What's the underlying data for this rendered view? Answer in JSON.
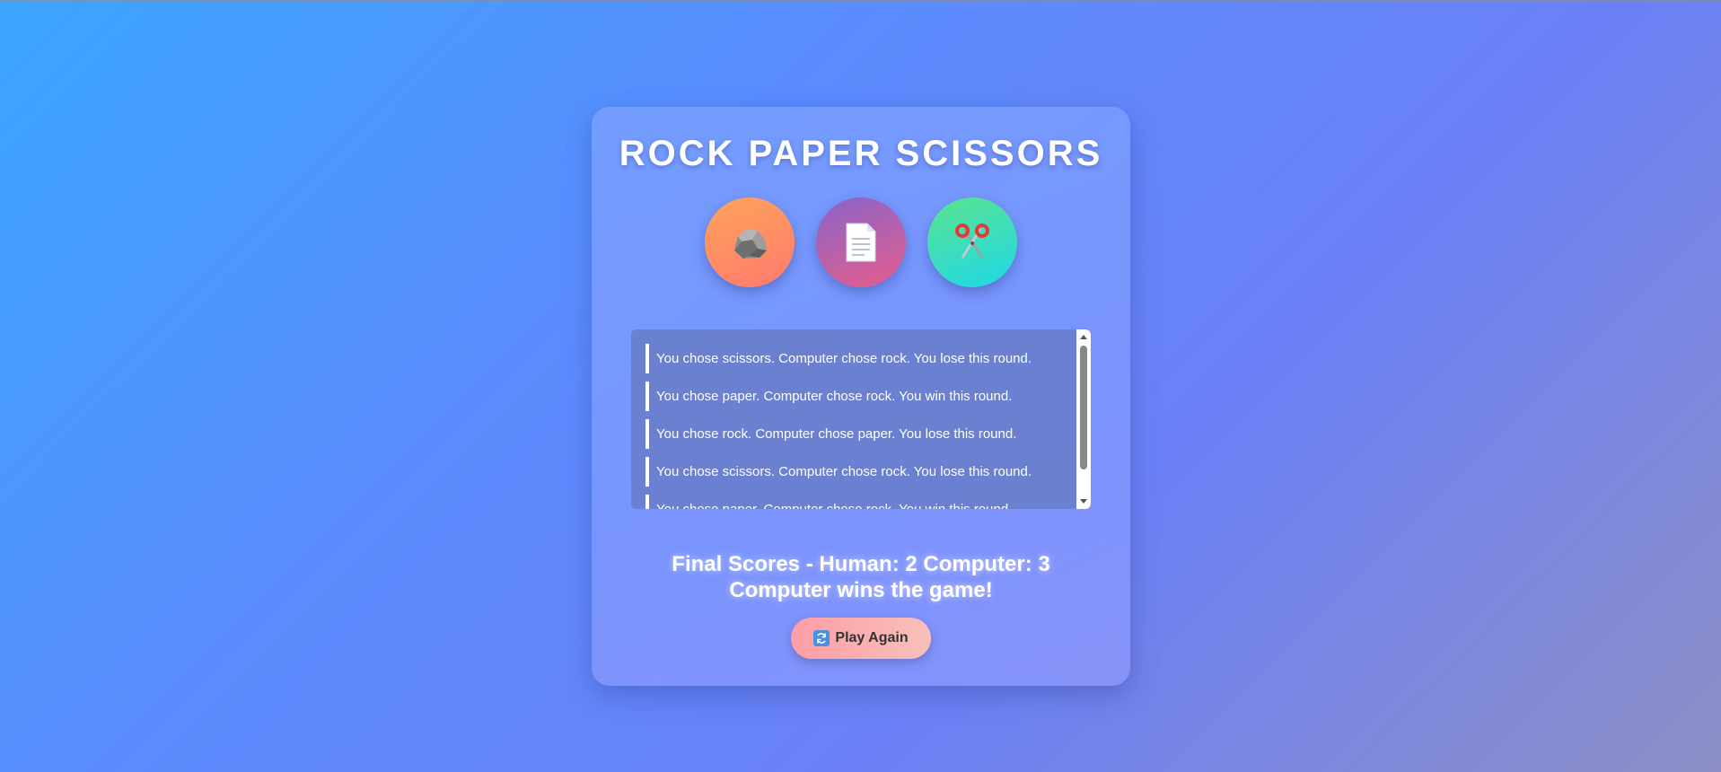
{
  "game": {
    "title": "ROCK PAPER SCISSORS",
    "choices": [
      {
        "id": "rock",
        "icon": "rock-icon"
      },
      {
        "id": "paper",
        "icon": "page-icon"
      },
      {
        "id": "scissors",
        "icon": "scissors-icon"
      }
    ]
  },
  "log": {
    "entries": [
      "You chose scissors. Computer chose rock. You lose this round.",
      "You chose paper. Computer chose rock. You win this round.",
      "You chose rock. Computer chose paper. You lose this round.",
      "You chose scissors. Computer chose rock. You lose this round.",
      "You chose paper. Computer chose rock. You win this round."
    ]
  },
  "result": {
    "final_scores": "Final Scores - Human: 2 Computer: 3",
    "winner": "Computer wins the game!"
  },
  "actions": {
    "play_again_label": "Play Again",
    "play_again_icon": "refresh-icon"
  },
  "colors": {
    "rock_gradient": [
      "#ffa35a",
      "#ff7a6e"
    ],
    "paper_gradient": [
      "#8a64c9",
      "#e65d8c"
    ],
    "scissors_gradient": [
      "#5be38e",
      "#1ed8e9"
    ],
    "play_again_gradient": [
      "#ff9da6",
      "#f7c0bb"
    ]
  }
}
